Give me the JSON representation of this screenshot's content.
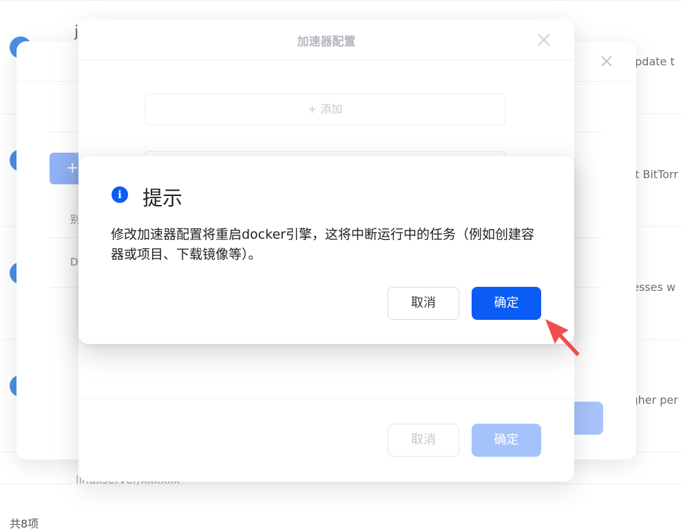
{
  "background": {
    "right_texts": [
      "update t",
      "ht BitTorr",
      "resses w",
      "igher per"
    ],
    "partial_texts": [
      "j",
      "别",
      "D",
      "linuxserver/xxxxxx"
    ],
    "footer": "共8项"
  },
  "accelerator_dialog_behind": {
    "add_symbol": "+"
  },
  "accelerator_dialog": {
    "title": "加速器配置",
    "add_label": "+ 添加",
    "cancel": "取消",
    "confirm": "确定"
  },
  "confirm_dialog": {
    "icon": "i",
    "icon_name": "info-icon",
    "title": "提示",
    "message": "修改加速器配置将重启docker引擎，这将中断运行中的任务（例如创建容器或项目、下载镜像等）。",
    "cancel": "取消",
    "confirm": "确定"
  },
  "colors": {
    "primary": "#0a5cf5",
    "primary_disabled": "#a5c2fb",
    "annotation_arrow": "#f04e4e"
  }
}
